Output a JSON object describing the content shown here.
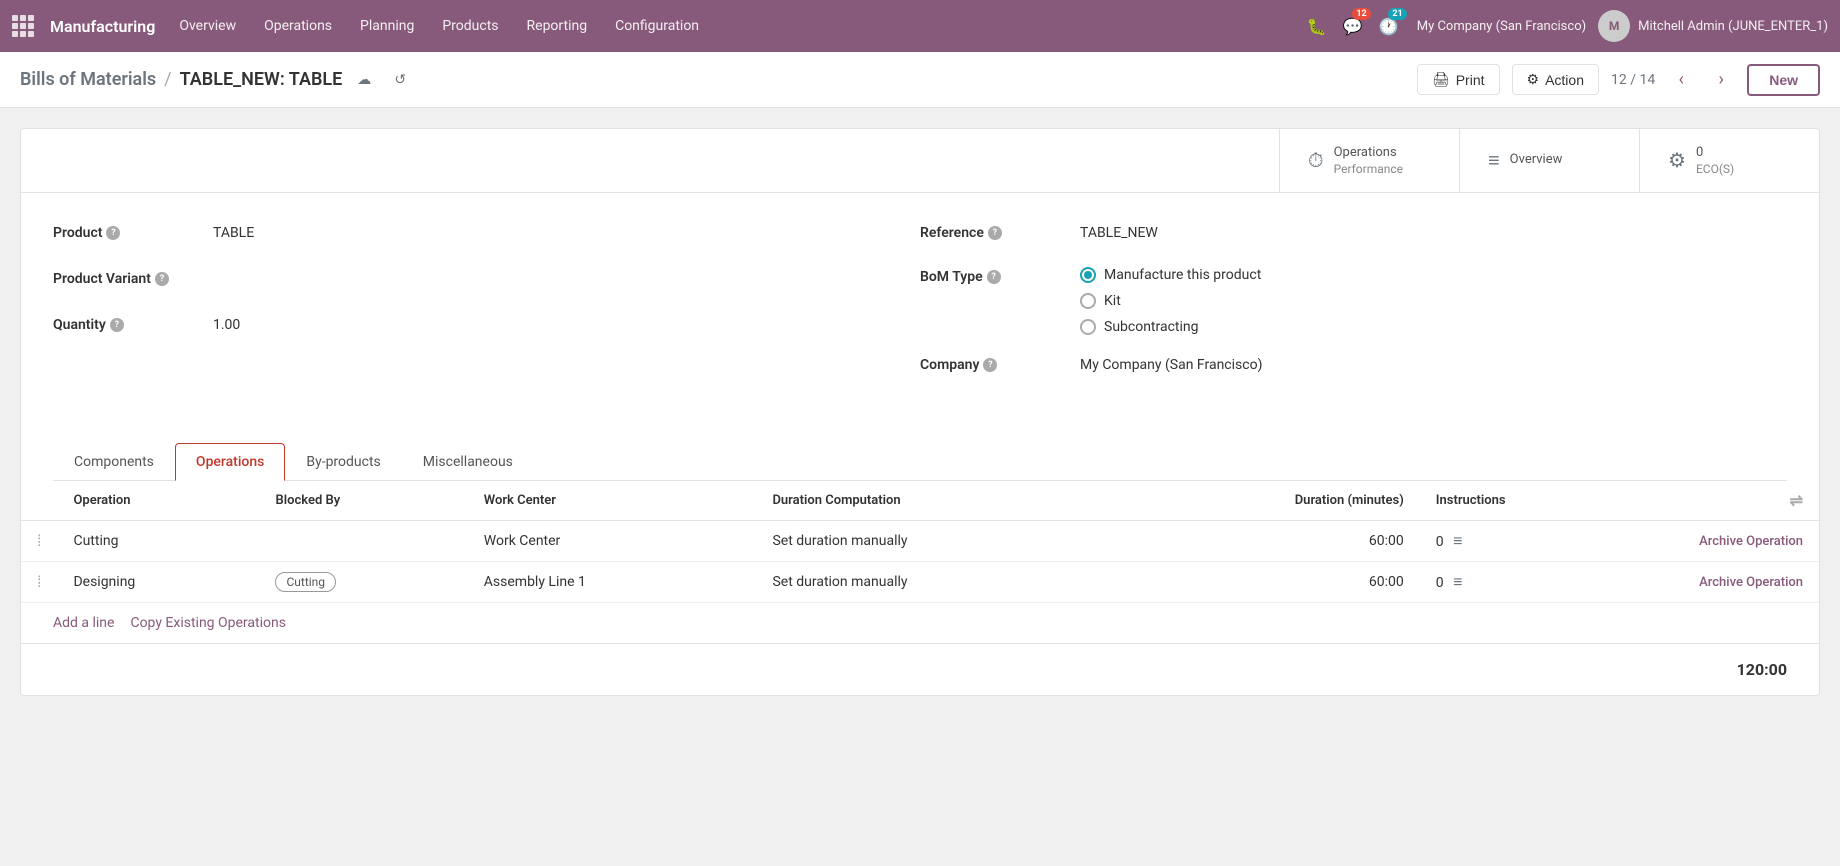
{
  "topnav": {
    "app_name": "Manufacturing",
    "nav_items": [
      "Overview",
      "Operations",
      "Planning",
      "Products",
      "Reporting",
      "Configuration"
    ],
    "chat_count": "12",
    "activity_count": "21",
    "company": "My Company (San Francisco)",
    "user": "Mitchell Admin (JUNE_ENTER_1)"
  },
  "breadcrumb": {
    "parent": "Bills of Materials",
    "separator": "/",
    "current": "TABLE_NEW: TABLE",
    "print_label": "Print",
    "action_label": "Action",
    "record_position": "12 / 14",
    "new_label": "New"
  },
  "stats": [
    {
      "id": "ops-performance",
      "icon": "⏱",
      "line1": "Operations",
      "line2": "Performance"
    },
    {
      "id": "overview",
      "icon": "≡",
      "line1": "Overview",
      "line2": ""
    },
    {
      "id": "ecos",
      "icon": "⚙",
      "line1": "0",
      "line2": "ECO(S)"
    }
  ],
  "form": {
    "product_label": "Product",
    "product_value": "TABLE",
    "product_variant_label": "Product Variant",
    "product_variant_value": "",
    "quantity_label": "Quantity",
    "quantity_value": "1.00",
    "reference_label": "Reference",
    "reference_value": "TABLE_NEW",
    "bom_type_label": "BoM Type",
    "bom_type_options": [
      "Manufacture this product",
      "Kit",
      "Subcontracting"
    ],
    "bom_type_selected": "Manufacture this product",
    "company_label": "Company",
    "company_value": "My Company (San Francisco)"
  },
  "tabs": [
    {
      "id": "components",
      "label": "Components",
      "active": false
    },
    {
      "id": "operations",
      "label": "Operations",
      "active": true
    },
    {
      "id": "byproducts",
      "label": "By-products",
      "active": false
    },
    {
      "id": "miscellaneous",
      "label": "Miscellaneous",
      "active": false
    }
  ],
  "operations_table": {
    "headers": [
      "",
      "Operation",
      "Blocked By",
      "Work Center",
      "Duration Computation",
      "Duration (minutes)",
      "Instructions",
      ""
    ],
    "rows": [
      {
        "operation": "Cutting",
        "blocked_by": "",
        "work_center": "Work Center",
        "duration_computation": "Set duration manually",
        "duration": "60:00",
        "instructions": "0",
        "archive_label": "Archive Operation"
      },
      {
        "operation": "Designing",
        "blocked_by": "Cutting",
        "work_center": "Assembly Line 1",
        "duration_computation": "Set duration manually",
        "duration": "60:00",
        "instructions": "0",
        "archive_label": "Archive Operation"
      }
    ],
    "add_line": "Add a line",
    "copy_operations": "Copy Existing Operations",
    "total": "120:00"
  }
}
